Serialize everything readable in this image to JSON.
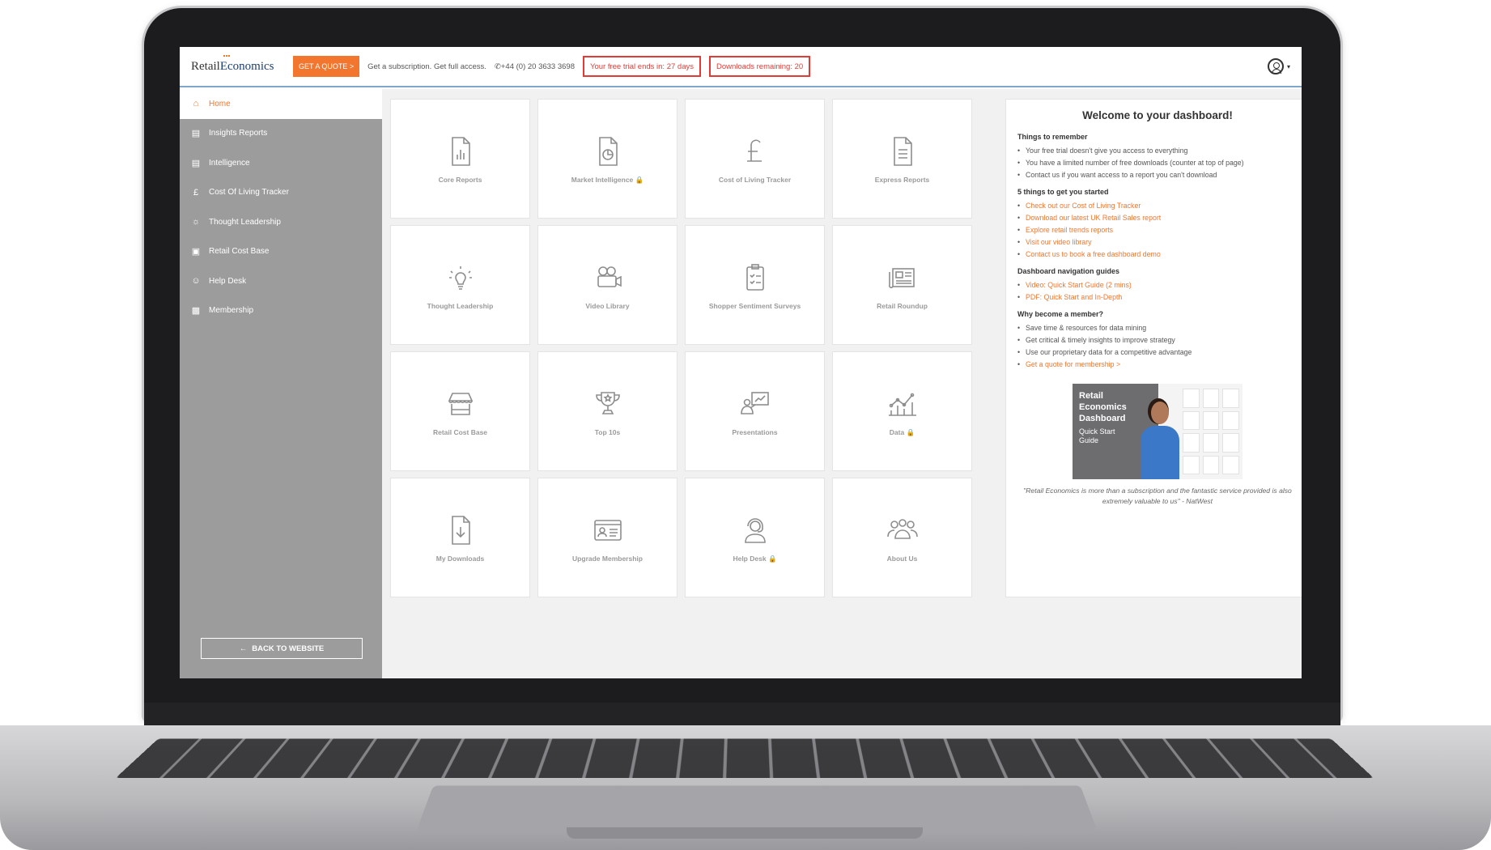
{
  "brand": {
    "logo_part1": "Retail",
    "logo_part2": "Economics",
    "accent_color": "#f2762e",
    "alert_color": "#e23b36",
    "sidebar_color": "#9c9c9c"
  },
  "topbar": {
    "quote_button": "GET A QUOTE >",
    "tagline": "Get a subscription. Get full access.",
    "phone": "+44 (0) 20 3633 3698",
    "trial_notice": "Your free trial ends in: 27 days",
    "downloads_notice": "Downloads remaining: 20"
  },
  "sidebar": {
    "items": [
      {
        "label": "Home",
        "icon": "home-icon"
      },
      {
        "label": "Insights Reports",
        "icon": "document-icon"
      },
      {
        "label": "Intelligence",
        "icon": "document-icon"
      },
      {
        "label": "Cost Of Living Tracker",
        "icon": "pound-icon"
      },
      {
        "label": "Thought Leadership",
        "icon": "lightbulb-icon"
      },
      {
        "label": "Retail Cost Base",
        "icon": "store-icon"
      },
      {
        "label": "Help Desk",
        "icon": "headset-icon"
      },
      {
        "label": "Membership",
        "icon": "id-card-icon"
      }
    ],
    "back_button": "BACK TO WEBSITE"
  },
  "tiles": [
    {
      "label": "Core Reports",
      "icon": "bar-chart-document-icon"
    },
    {
      "label": "Market Intelligence",
      "icon": "pie-chart-document-icon",
      "locked": true
    },
    {
      "label": "Cost of Living Tracker",
      "icon": "pound-icon"
    },
    {
      "label": "Express Reports",
      "icon": "text-document-icon"
    },
    {
      "label": "Thought Leadership",
      "icon": "lightbulb-icon"
    },
    {
      "label": "Video Library",
      "icon": "video-camera-icon"
    },
    {
      "label": "Shopper Sentiment Surveys",
      "icon": "clipboard-icon"
    },
    {
      "label": "Retail Roundup",
      "icon": "newspaper-icon"
    },
    {
      "label": "Retail Cost Base",
      "icon": "store-icon"
    },
    {
      "label": "Top 10s",
      "icon": "trophy-icon"
    },
    {
      "label": "Presentations",
      "icon": "presenter-icon"
    },
    {
      "label": "Data",
      "icon": "growth-chart-icon",
      "locked": true
    },
    {
      "label": "My Downloads",
      "icon": "download-document-icon"
    },
    {
      "label": "Upgrade Membership",
      "icon": "id-card-icon"
    },
    {
      "label": "Help Desk",
      "icon": "headset-icon",
      "locked": true
    },
    {
      "label": "About Us",
      "icon": "team-icon"
    }
  ],
  "welcome": {
    "title": "Welcome to your dashboard!",
    "remember_heading": "Things to remember",
    "remember": [
      "Your free trial doesn't give you access to everything",
      "You have a limited number of free downloads (counter at top of page)",
      "Contact us if you want access to a report you can't download"
    ],
    "started_heading": "5 things to get you started",
    "started": [
      "Check out our Cost of Living Tracker",
      "Download our latest UK Retail Sales report",
      "Explore retail trends reports",
      "Visit our video library",
      "Contact us to book a free dashboard demo"
    ],
    "guides_heading": "Dashboard navigation guides",
    "guides": [
      "Video: Quick Start Guide (2 mins)",
      "PDF: Quick Start and In-Depth"
    ],
    "member_heading": "Why become a member?",
    "member": [
      "Save time & resources for data mining",
      "Get critical & timely insights to improve strategy",
      "Use our proprietary data for a competitive advantage"
    ],
    "member_link": "Get a quote for membership >",
    "guide_image": {
      "line1": "Retail",
      "line2": "Economics",
      "line3": "Dashboard",
      "line4": "Quick Start",
      "line5": "Guide"
    },
    "testimonial": "\"Retail Economics is more than a subscription and the fantastic service provided is also extremely valuable to us\" - NatWest"
  }
}
